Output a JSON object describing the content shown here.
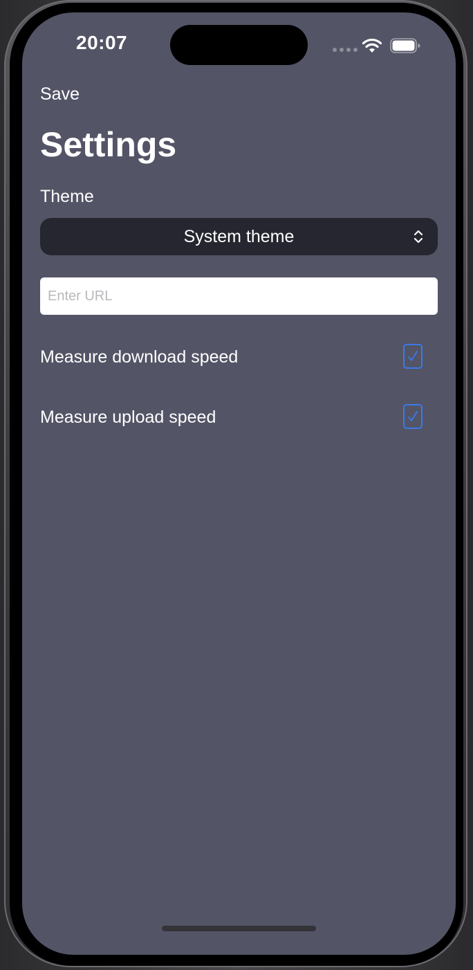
{
  "status_bar": {
    "time": "20:07",
    "icons": [
      "cellular-dots-icon",
      "wifi-icon",
      "battery-icon"
    ]
  },
  "nav": {
    "save_label": "Save"
  },
  "page": {
    "title": "Settings"
  },
  "theme": {
    "label": "Theme",
    "selected": "System theme",
    "icon": "chevron-up-down-icon"
  },
  "url": {
    "value": "",
    "placeholder": "Enter URL"
  },
  "options": [
    {
      "label": "Measure download speed",
      "checked": true
    },
    {
      "label": "Measure upload speed",
      "checked": true
    }
  ],
  "colors": {
    "screen_background": "#535466",
    "picker_background": "#25262f",
    "checkbox_accent": "#3b7ae8",
    "text": "#ffffff"
  }
}
